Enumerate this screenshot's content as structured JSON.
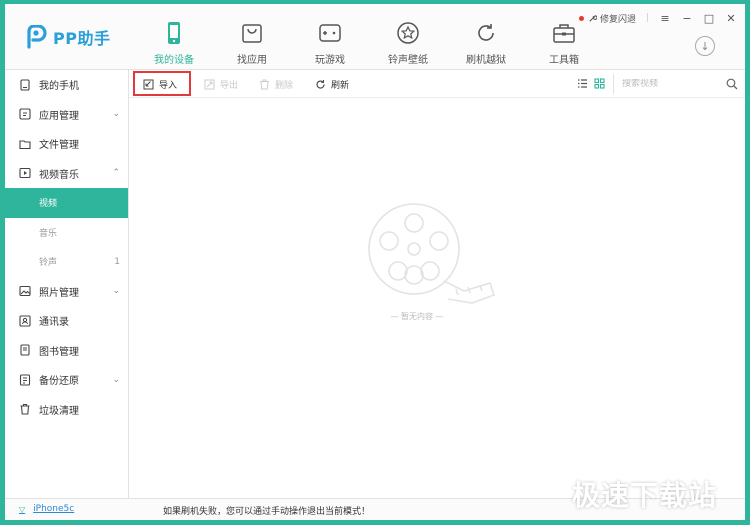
{
  "app": {
    "logo_text": "PP助手",
    "brand_color": "#2fb59b"
  },
  "nav": [
    {
      "label": "我的设备",
      "icon": "phone-icon",
      "active": true
    },
    {
      "label": "找应用",
      "icon": "bag-icon"
    },
    {
      "label": "玩游戏",
      "icon": "gamepad-icon"
    },
    {
      "label": "铃声壁纸",
      "icon": "star-icon"
    },
    {
      "label": "刷机越狱",
      "icon": "refresh-circle-icon"
    },
    {
      "label": "工具箱",
      "icon": "toolbox-icon",
      "badge": true
    }
  ],
  "topbar": {
    "repair_label": "修复闪退"
  },
  "sidebar": {
    "items": [
      {
        "label": "我的手机",
        "icon": "phone-icon"
      },
      {
        "label": "应用管理",
        "icon": "apps-icon",
        "chevron": "down"
      },
      {
        "label": "文件管理",
        "icon": "folder-icon"
      },
      {
        "label": "视频音乐",
        "icon": "video-icon",
        "chevron": "up"
      },
      {
        "label": "照片管理",
        "icon": "photo-icon",
        "chevron": "down"
      },
      {
        "label": "通讯录",
        "icon": "contacts-icon"
      },
      {
        "label": "图书管理",
        "icon": "book-icon"
      },
      {
        "label": "备份还原",
        "icon": "backup-icon",
        "chevron": "down"
      },
      {
        "label": "垃圾清理",
        "icon": "trash-icon"
      }
    ],
    "sub_items": [
      {
        "label": "视频",
        "active": true
      },
      {
        "label": "音乐"
      },
      {
        "label": "铃声",
        "count": "1"
      }
    ]
  },
  "toolbar": {
    "import_label": "导入",
    "export_label": "导出",
    "delete_label": "删除",
    "refresh_label": "刷新",
    "search_placeholder": "搜索视频"
  },
  "empty_state": {
    "text": "— 暂无内容 —"
  },
  "statusbar": {
    "device_name": "iPhone5c",
    "message": "如果刷机失败，您可以通过手动操作退出当前模式！"
  },
  "watermark": "极速下载站"
}
